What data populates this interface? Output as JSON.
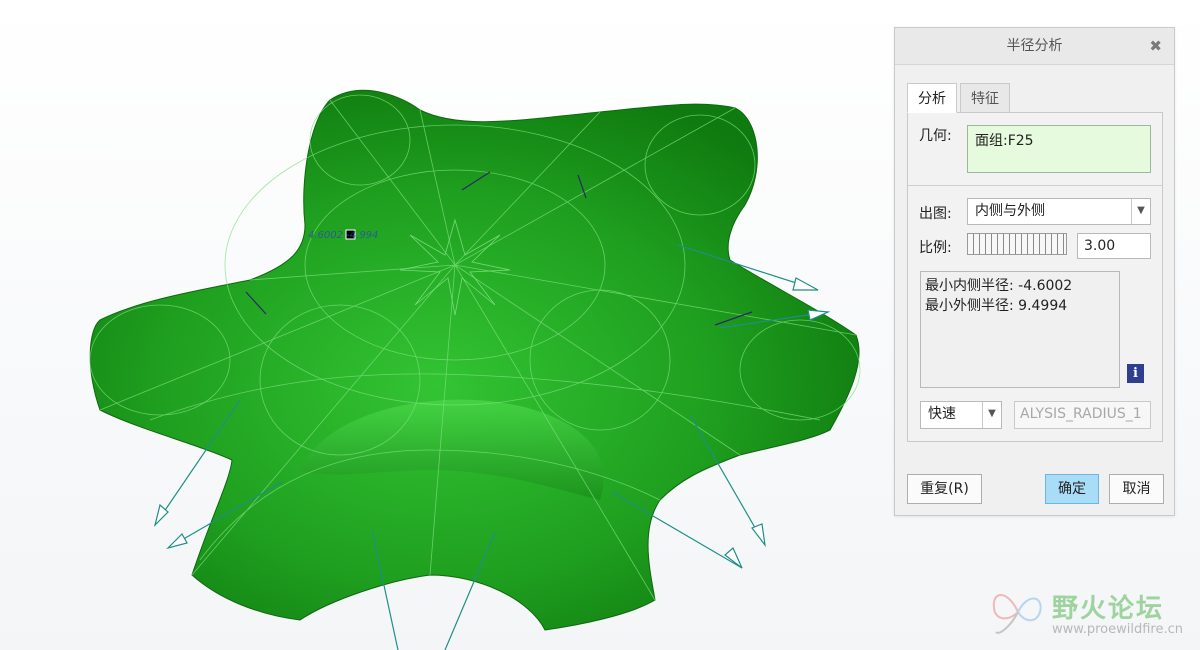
{
  "dialog": {
    "title": "半径分析",
    "close_glyph": "✖",
    "tabs": [
      {
        "label": "分析",
        "active": true
      },
      {
        "label": "特征",
        "active": false
      }
    ],
    "geometry": {
      "label": "几何:",
      "value": "面组:F25"
    },
    "output": {
      "label": "出图:",
      "value": "内侧与外侧"
    },
    "scale": {
      "label": "比例:",
      "value": "3.00"
    },
    "results": {
      "line1": "最小内侧半径: -4.6002",
      "line2": "最小外侧半径: 9.4994"
    },
    "info_icon": "i",
    "mode": {
      "value": "快速"
    },
    "name": {
      "value": "ALYSIS_RADIUS_1"
    },
    "buttons": {
      "repeat": "重复(R)",
      "ok": "确定",
      "cancel": "取消"
    }
  },
  "viewport": {
    "annotation": "4.6002 -4.994",
    "colors": {
      "surface": "#1e9a1e",
      "mesh": "#7ee07e",
      "arrow": "#1f8f86",
      "arrow_inner": "#2a2a66"
    }
  },
  "watermark": {
    "title": "野火论坛",
    "url": "www.proewildfire.cn"
  }
}
